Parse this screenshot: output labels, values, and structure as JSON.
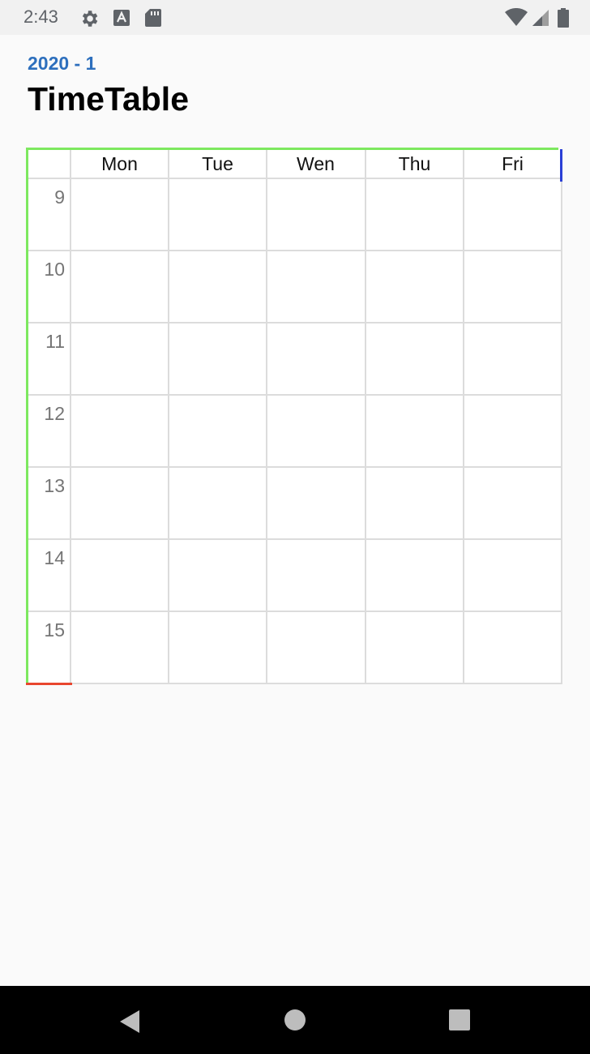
{
  "status_bar": {
    "time": "2:43",
    "icons": [
      "settings-icon",
      "keyboard-a-icon",
      "sd-card-icon",
      "wifi-icon",
      "signal-icon",
      "battery-icon"
    ]
  },
  "header": {
    "semester": "2020 - 1",
    "title": "TimeTable"
  },
  "timetable": {
    "days": [
      "Mon",
      "Tue",
      "Wen",
      "Thu",
      "Fri"
    ],
    "hours": [
      "9",
      "10",
      "11",
      "12",
      "13",
      "14",
      "15"
    ]
  },
  "colors": {
    "accent": "#2d6fbd",
    "grid_border_top_left": "#7de85f",
    "grid_border_right": "#2a3fd6",
    "grid_border_bottom": "#e8462f"
  },
  "nav_bar": {
    "icons": [
      "back-icon",
      "home-icon",
      "recents-icon"
    ]
  }
}
